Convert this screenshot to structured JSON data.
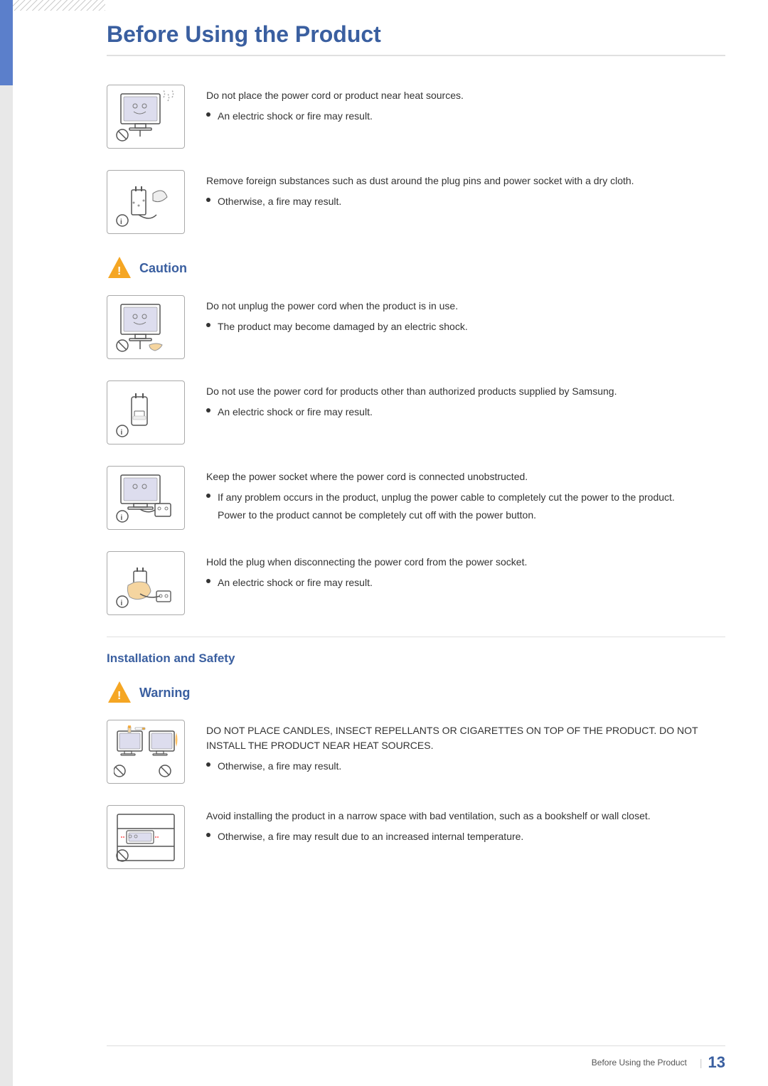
{
  "page": {
    "title": "Before Using the Product",
    "footer_text": "Before Using the Product",
    "page_number": "13"
  },
  "caution_section": {
    "label": "Caution",
    "items": [
      {
        "id": "caution-1",
        "main_text": "Do not unplug the power cord when the product is in use.",
        "bullet": "The product may become damaged by an electric shock."
      },
      {
        "id": "caution-2",
        "main_text": "Do not use the power cord for products other than authorized products supplied by Samsung.",
        "bullet": "An electric shock or fire may result."
      },
      {
        "id": "caution-3",
        "main_text": "Keep the power socket where the power cord is connected unobstructed.",
        "bullet": "If any problem occurs in the product, unplug the power cable to completely cut the power to the product.",
        "sub_text": "Power to the product cannot be completely cut off with the power button."
      },
      {
        "id": "caution-4",
        "main_text": "Hold the plug when disconnecting the power cord from the power socket.",
        "bullet": "An electric shock or fire may result."
      }
    ]
  },
  "pre_caution_items": [
    {
      "id": "pre-1",
      "main_text": "Do not place the power cord or product near heat sources.",
      "bullet": "An electric shock or fire may result."
    },
    {
      "id": "pre-2",
      "main_text": "Remove foreign substances such as dust around the plug pins and power socket with a dry cloth.",
      "bullet": "Otherwise, a fire may result."
    }
  ],
  "installation_section": {
    "label": "Installation and Safety"
  },
  "warning_section": {
    "label": "Warning",
    "items": [
      {
        "id": "warning-1",
        "main_text": "DO NOT PLACE CANDLES, INSECT REPELLANTS OR CIGARETTES ON TOP OF THE PRODUCT. DO NOT INSTALL THE PRODUCT NEAR HEAT SOURCES.",
        "bullet": "Otherwise, a fire may result."
      },
      {
        "id": "warning-2",
        "main_text": "Avoid installing the product in a narrow space with bad ventilation, such as a bookshelf or wall closet.",
        "bullet": "Otherwise, a fire may result due to an increased internal temperature."
      }
    ]
  }
}
